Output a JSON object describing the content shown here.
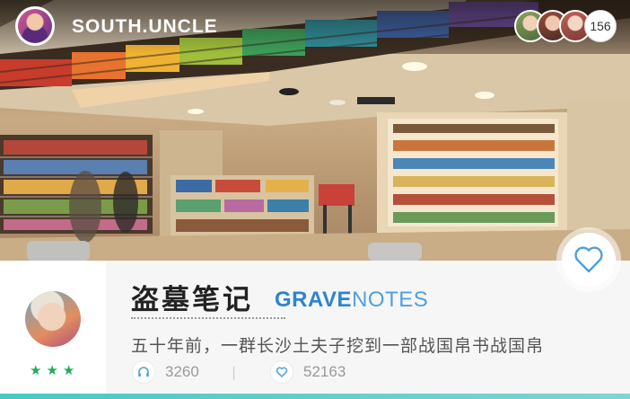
{
  "header": {
    "username": "SOUTH.UNCLE",
    "viewer_count": "156"
  },
  "article": {
    "title_cn": "盗墓笔记",
    "title_en_strong": "GRAVE",
    "title_en_light": "NOTES",
    "description": "五十年前，一群长沙土夫子挖到一部战国帛书战国帛",
    "rating_stars": 3,
    "listens": "3260",
    "divider": "|",
    "likes": "52163"
  },
  "icons": {
    "user_avatar": "avatar",
    "viewers": "avatar-group",
    "fav": "heart-icon",
    "listens": "headphones-icon",
    "likes": "heart-icon",
    "rating": "star-icon"
  },
  "colors": {
    "accent_blue": "#2d84cf",
    "star_green": "#1fae5a",
    "bottom_bar": "#46c9c4"
  }
}
